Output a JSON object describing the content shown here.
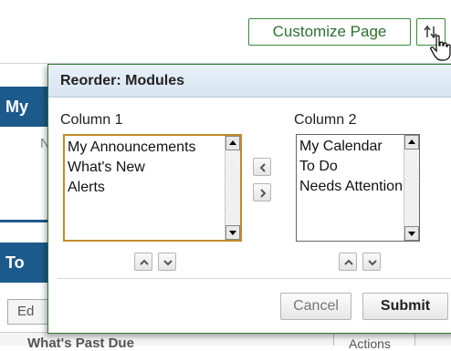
{
  "toolbar": {
    "customize_label": "Customize Page"
  },
  "background": {
    "panel1_title": "My",
    "panel1_text": "N",
    "panel2_title": "To",
    "edit_label": "Ed",
    "row_left_label": "What's Past Due",
    "row_actions_label": "Actions"
  },
  "dialog": {
    "title": "Reorder: Modules",
    "column1": {
      "label": "Column 1",
      "items": [
        "My Announcements",
        "What's New",
        "Alerts"
      ]
    },
    "column2": {
      "label": "Column 2",
      "items": [
        "My Calendar",
        "To Do",
        "Needs Attention"
      ]
    },
    "cancel_label": "Cancel",
    "submit_label": "Submit"
  },
  "colors": {
    "accent_green": "#2f7a2f",
    "header_blue": "#1d5a8c",
    "selected_border": "#c28a2b"
  },
  "icons": [
    "reorder-arrows-icon",
    "hand-cursor-icon",
    "chevron-left-icon",
    "chevron-right-icon",
    "chevron-up-icon",
    "chevron-down-icon"
  ]
}
